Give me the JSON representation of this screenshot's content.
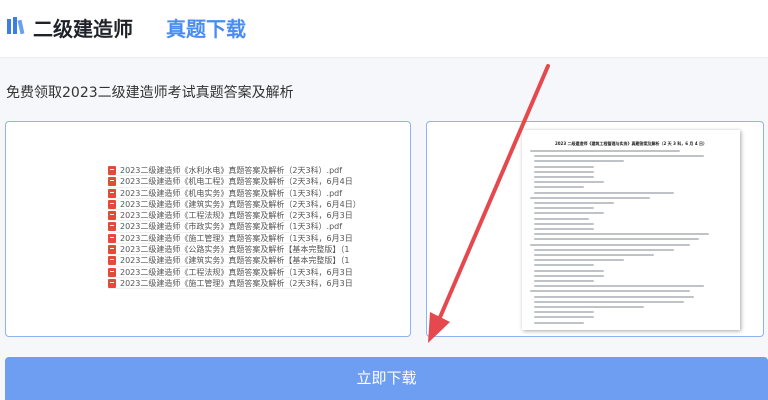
{
  "header": {
    "title_main": "二级建造师",
    "title_sub": "真题下载",
    "icon": "books-icon",
    "accent_color": "#4a8cf0"
  },
  "subtitle": "免费领取2023二级建造师考试真题答案及解析",
  "files": [
    "2023二级建造师《水利水电》真题答案及解析（2天3科）.pdf",
    "2023二级建造师《机电工程》真题答案及解析（2天3科，6月4日",
    "2023二级建造师《机电实务》真题答案及解析（1天3科）.pdf",
    "2023二级建造师《建筑实务》真题答案及解析（2天3科，6月4日）",
    "2023二级建造师《工程法规》真题答案及解析（2天3科，6月3日",
    "2023二级建造师《市政实务》真题答案及解析（1天3科）.pdf",
    "2023二级建造师《施工管理》真题答案及解析（1天3科，6月3日",
    "2023二级建造师《公路实务》真题答案及解析【基本完整版】（1",
    "2023二级建造师《建筑实务》真题答案及解析【基本完整版】（1",
    "2023二级建造师《工程法规》真题答案及解析（1天3科，6月3日",
    "2023二级建造师《施工管理》真题答案及解析（2天3科，6月3日"
  ],
  "file_icon": "pdf-file-icon",
  "doc_preview": {
    "heading": "2023 二级建造师《建筑工程管理与实务》真题答案及解析（2 天 3 科，6 月 4 日）"
  },
  "download_button": "立即下载",
  "arrow_color": "#e5484d",
  "button_color": "#6e9ef1"
}
